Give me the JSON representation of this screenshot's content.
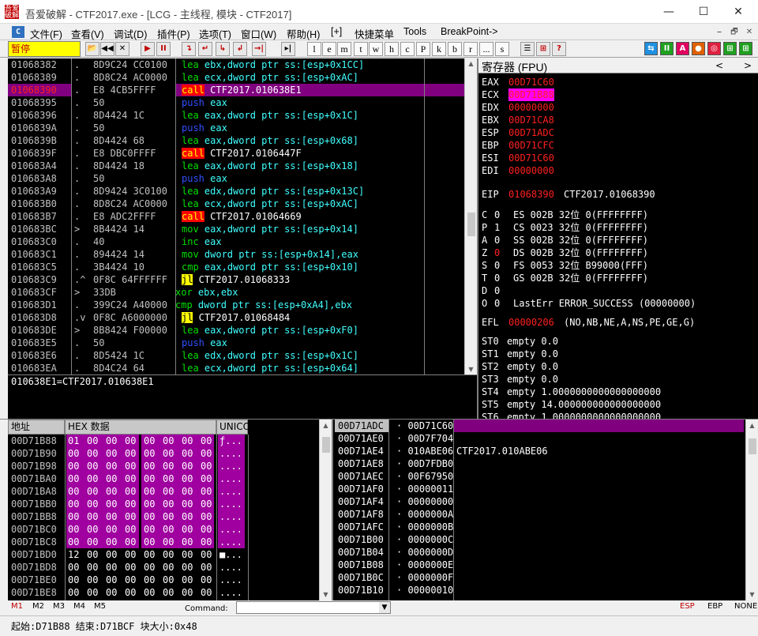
{
  "window": {
    "title": "吾爱破解 - CTF2017.exe - [LCG - 主线程, 模块 - CTF2017]",
    "icon": "吾爱破解",
    "minimize": "—",
    "maximize": "☐",
    "close": "✕"
  },
  "menu": {
    "icon": "C",
    "items": [
      "文件(F)",
      "查看(V)",
      "调试(D)",
      "插件(P)",
      "选项(T)",
      "窗口(W)",
      "帮助(H)",
      "[+]",
      "快捷菜单",
      "Tools",
      "BreakPoint->"
    ],
    "mdi": [
      "⎯",
      "🗗",
      "✕"
    ]
  },
  "toolbar": {
    "state": "暂停",
    "buttons": [
      "📂",
      "◀◀",
      "✕",
      "▶",
      "II",
      "↴",
      "↵",
      "↳",
      "↲",
      "→|",
      "▸|"
    ],
    "letters": [
      "l",
      "e",
      "m",
      "t",
      "w",
      "h",
      "c",
      "P",
      "k",
      "b",
      "r",
      "...",
      "s"
    ],
    "right": [
      "☰",
      "⊞",
      "?"
    ],
    "colorbtns": [
      "⇆",
      "II",
      "A",
      "●",
      "◎",
      "⊞",
      "⊞",
      "⊞",
      "⊞",
      "⊞"
    ]
  },
  "disasm": {
    "rows": [
      {
        "addr": "01068382",
        "mark": ".",
        "hex": "8D9C24 CC0100",
        "asm": [
          {
            "t": "lea ",
            "c": "green"
          },
          {
            "t": "ebx",
            "c": "cyan"
          },
          {
            "t": ",dword ptr ss:[esp+0x1CC]",
            "c": "cyan"
          }
        ]
      },
      {
        "addr": "01068389",
        "mark": ".",
        "hex": "8D8C24 AC0000",
        "asm": [
          {
            "t": "lea ",
            "c": "green"
          },
          {
            "t": "ecx",
            "c": "cyan"
          },
          {
            "t": ",dword ptr ss:[esp+0xAC]",
            "c": "cyan"
          }
        ]
      },
      {
        "addr": "01068390",
        "mark": ".",
        "hex": "E8 4CB5FFFF",
        "sel": true,
        "asm": [
          {
            "t": "call",
            "c": "callbox"
          },
          {
            "t": " CTF2017.010638E1",
            "c": "white"
          }
        ]
      },
      {
        "addr": "01068395",
        "mark": ".",
        "hex": "50",
        "asm": [
          {
            "t": "push ",
            "c": "blue"
          },
          {
            "t": "eax",
            "c": "cyan"
          }
        ]
      },
      {
        "addr": "01068396",
        "mark": ".",
        "hex": "8D4424 1C",
        "asm": [
          {
            "t": "lea ",
            "c": "green"
          },
          {
            "t": "eax",
            "c": "cyan"
          },
          {
            "t": ",dword ptr ss:[esp+0x1C]",
            "c": "cyan"
          }
        ]
      },
      {
        "addr": "0106839A",
        "mark": ".",
        "hex": "50",
        "asm": [
          {
            "t": "push ",
            "c": "blue"
          },
          {
            "t": "eax",
            "c": "cyan"
          }
        ]
      },
      {
        "addr": "0106839B",
        "mark": ".",
        "hex": "8D4424 68",
        "asm": [
          {
            "t": "lea ",
            "c": "green"
          },
          {
            "t": "eax",
            "c": "cyan"
          },
          {
            "t": ",dword ptr ss:[esp+0x68]",
            "c": "cyan"
          }
        ]
      },
      {
        "addr": "0106839F",
        "mark": ".",
        "hex": "E8 DBC0FFFF",
        "asm": [
          {
            "t": "call",
            "c": "callbox"
          },
          {
            "t": " CTF2017.0106447F",
            "c": "white"
          }
        ]
      },
      {
        "addr": "010683A4",
        "mark": ".",
        "hex": "8D4424 18",
        "asm": [
          {
            "t": "lea ",
            "c": "green"
          },
          {
            "t": "eax",
            "c": "cyan"
          },
          {
            "t": ",dword ptr ss:[esp+0x18]",
            "c": "cyan"
          }
        ]
      },
      {
        "addr": "010683A8",
        "mark": ".",
        "hex": "50",
        "asm": [
          {
            "t": "push ",
            "c": "blue"
          },
          {
            "t": "eax",
            "c": "cyan"
          }
        ]
      },
      {
        "addr": "010683A9",
        "mark": ".",
        "hex": "8D9424 3C0100",
        "asm": [
          {
            "t": "lea ",
            "c": "green"
          },
          {
            "t": "edx",
            "c": "cyan"
          },
          {
            "t": ",dword ptr ss:[esp+0x13C]",
            "c": "cyan"
          }
        ]
      },
      {
        "addr": "010683B0",
        "mark": ".",
        "hex": "8D8C24 AC0000",
        "asm": [
          {
            "t": "lea ",
            "c": "green"
          },
          {
            "t": "ecx",
            "c": "cyan"
          },
          {
            "t": ",dword ptr ss:[esp+0xAC]",
            "c": "cyan"
          }
        ]
      },
      {
        "addr": "010683B7",
        "mark": ".",
        "hex": "E8 ADC2FFFF",
        "asm": [
          {
            "t": "call",
            "c": "callbox"
          },
          {
            "t": " CTF2017.01064669",
            "c": "white"
          }
        ]
      },
      {
        "addr": "010683BC",
        "mark": ">",
        "hex": "8B4424 14",
        "asm": [
          {
            "t": "mov ",
            "c": "green"
          },
          {
            "t": "eax",
            "c": "cyan"
          },
          {
            "t": ",dword ptr ss:[esp+0x14]",
            "c": "cyan"
          }
        ]
      },
      {
        "addr": "010683C0",
        "mark": ".",
        "hex": "40",
        "asm": [
          {
            "t": "inc ",
            "c": "green"
          },
          {
            "t": "eax",
            "c": "cyan"
          }
        ]
      },
      {
        "addr": "010683C1",
        "mark": ".",
        "hex": "894424 14",
        "asm": [
          {
            "t": "mov ",
            "c": "green"
          },
          {
            "t": "dword ptr ss:[esp+0x14],eax",
            "c": "cyan"
          }
        ]
      },
      {
        "addr": "010683C5",
        "mark": ".",
        "hex": "3B4424 10",
        "asm": [
          {
            "t": "cmp ",
            "c": "green"
          },
          {
            "t": "eax",
            "c": "cyan"
          },
          {
            "t": ",dword ptr ss:[esp+0x10]",
            "c": "cyan"
          }
        ]
      },
      {
        "addr": "010683C9",
        "mark": ".^",
        "hex": "0F8C 64FFFFFF",
        "asm": [
          {
            "t": "jl",
            "c": "jlbox"
          },
          {
            "t": " CTF2017.01068333",
            "c": "white"
          }
        ]
      },
      {
        "addr": "010683CF",
        "mark": ">",
        "hex": "33DB",
        "asm": [
          {
            "t": "xor ",
            "c": "green"
          },
          {
            "t": "ebx",
            "c": "cyan"
          },
          {
            "t": ",ebx",
            "c": "cyan"
          }
        ],
        "shift": true
      },
      {
        "addr": "010683D1",
        "mark": ".",
        "hex": "399C24 A40000",
        "asm": [
          {
            "t": "cmp ",
            "c": "green"
          },
          {
            "t": "dword ptr ss:[esp+0xA4],ebx",
            "c": "cyan"
          }
        ],
        "shift": true
      },
      {
        "addr": "010683D8",
        "mark": ".v",
        "hex": "0F8C A6000000",
        "asm": [
          {
            "t": "jl",
            "c": "jlbox"
          },
          {
            "t": " CTF2017.01068484",
            "c": "white"
          }
        ]
      },
      {
        "addr": "010683DE",
        "mark": ">",
        "hex": "8B8424 F00000",
        "asm": [
          {
            "t": "lea ",
            "c": "green"
          },
          {
            "t": "eax",
            "c": "cyan"
          },
          {
            "t": ",dword ptr ss:[esp+0xF0]",
            "c": "cyan"
          }
        ]
      },
      {
        "addr": "010683E5",
        "mark": ".",
        "hex": "50",
        "asm": [
          {
            "t": "push ",
            "c": "blue"
          },
          {
            "t": "eax",
            "c": "cyan"
          }
        ]
      },
      {
        "addr": "010683E6",
        "mark": ".",
        "hex": "8D5424 1C",
        "asm": [
          {
            "t": "lea ",
            "c": "green"
          },
          {
            "t": "edx",
            "c": "cyan"
          },
          {
            "t": ",dword ptr ss:[esp+0x1C]",
            "c": "cyan"
          }
        ]
      },
      {
        "addr": "010683EA",
        "mark": ".",
        "hex": "8D4C24 64",
        "asm": [
          {
            "t": "lea ",
            "c": "green"
          },
          {
            "t": "ecx",
            "c": "cyan"
          },
          {
            "t": ",dword ptr ss:[esp+0x64]",
            "c": "cyan"
          }
        ]
      }
    ],
    "info": "010638E1=CTF2017.010638E1"
  },
  "registers": {
    "title": "寄存器 (FPU)",
    "gp": [
      [
        "EAX",
        "00D71C60"
      ],
      [
        "ECX",
        "00D71B88"
      ],
      [
        "EDX",
        "00000000"
      ],
      [
        "EBX",
        "00D71CA8"
      ],
      [
        "ESP",
        "00D71ADC"
      ],
      [
        "EBP",
        "00D71CFC"
      ],
      [
        "ESI",
        "00D71C60"
      ],
      [
        "EDI",
        "00000000"
      ]
    ],
    "eip": {
      "name": "EIP",
      "value": "01068390",
      "comment": "CTF2017.01068390"
    },
    "flags": [
      [
        "C",
        "0",
        "ES 002B 32位 0(FFFFFFFF)"
      ],
      [
        "P",
        "1",
        "CS 0023 32位 0(FFFFFFFF)"
      ],
      [
        "A",
        "0",
        "SS 002B 32位 0(FFFFFFFF)"
      ],
      [
        "Z",
        "0",
        "DS 002B 32位 0(FFFFFFFF)"
      ],
      [
        "S",
        "0",
        "FS 0053 32位 B99000(FFF)"
      ],
      [
        "T",
        "0",
        "GS 002B 32位 0(FFFFFFFF)"
      ],
      [
        "D",
        "0",
        ""
      ],
      [
        "O",
        "0",
        "LastErr ERROR_SUCCESS (00000000)"
      ]
    ],
    "efl": {
      "name": "EFL",
      "value": "00000206",
      "comment": "(NO,NB,NE,A,NS,PE,GE,G)"
    },
    "fpu": [
      [
        "ST0",
        "empty 0.0"
      ],
      [
        "ST1",
        "empty 0.0"
      ],
      [
        "ST2",
        "empty 0.0"
      ],
      [
        "ST3",
        "empty 0.0"
      ],
      [
        "ST4",
        "empty 1.0000000000000000000"
      ],
      [
        "ST5",
        "empty 14.000000000000000000"
      ],
      [
        "ST6",
        "empty 1.0000000000000000000"
      ]
    ]
  },
  "dump": {
    "headers": [
      "地址",
      "HEX 数据",
      "UNICO"
    ],
    "rows": [
      {
        "addr": "00D71B88",
        "hex": [
          "01",
          "00",
          "00",
          "00",
          "00",
          "00",
          "00",
          "00"
        ],
        "mag": true,
        "uni": "ƒ..."
      },
      {
        "addr": "00D71B90",
        "hex": [
          "00",
          "00",
          "00",
          "00",
          "00",
          "00",
          "00",
          "00"
        ],
        "mag": true,
        "uni": "...."
      },
      {
        "addr": "00D71B98",
        "hex": [
          "00",
          "00",
          "00",
          "00",
          "00",
          "00",
          "00",
          "00"
        ],
        "mag": true,
        "uni": "...."
      },
      {
        "addr": "00D71BA0",
        "hex": [
          "00",
          "00",
          "00",
          "00",
          "00",
          "00",
          "00",
          "00"
        ],
        "mag": true,
        "uni": "...."
      },
      {
        "addr": "00D71BA8",
        "hex": [
          "00",
          "00",
          "00",
          "00",
          "00",
          "00",
          "00",
          "00"
        ],
        "mag": true,
        "uni": "...."
      },
      {
        "addr": "00D71BB0",
        "hex": [
          "00",
          "00",
          "00",
          "00",
          "00",
          "00",
          "00",
          "00"
        ],
        "mag": true,
        "uni": "...."
      },
      {
        "addr": "00D71BB8",
        "hex": [
          "00",
          "00",
          "00",
          "00",
          "00",
          "00",
          "00",
          "00"
        ],
        "mag": true,
        "uni": "...."
      },
      {
        "addr": "00D71BC0",
        "hex": [
          "00",
          "00",
          "00",
          "00",
          "00",
          "00",
          "00",
          "00"
        ],
        "mag": true,
        "uni": "...."
      },
      {
        "addr": "00D71BC8",
        "hex": [
          "00",
          "00",
          "00",
          "00",
          "00",
          "00",
          "00",
          "00"
        ],
        "mag": true,
        "uni": "...."
      },
      {
        "addr": "00D71BD0",
        "hex": [
          "12",
          "00",
          "00",
          "00",
          "00",
          "00",
          "00",
          "00"
        ],
        "mag": false,
        "uni": "■..."
      },
      {
        "addr": "00D71BD8",
        "hex": [
          "00",
          "00",
          "00",
          "00",
          "00",
          "00",
          "00",
          "00"
        ],
        "mag": false,
        "uni": "...."
      },
      {
        "addr": "00D71BE0",
        "hex": [
          "00",
          "00",
          "00",
          "00",
          "00",
          "00",
          "00",
          "00"
        ],
        "mag": false,
        "uni": "...."
      },
      {
        "addr": "00D71BE8",
        "hex": [
          "00",
          "00",
          "00",
          "00",
          "00",
          "00",
          "00",
          "00"
        ],
        "mag": false,
        "uni": "...."
      }
    ]
  },
  "stack": {
    "rows": [
      {
        "addr": "00D71ADC",
        "val": "00D71C60",
        "comment": "",
        "sel": true
      },
      {
        "addr": "00D71AE0",
        "val": "00D7F704",
        "comment": ""
      },
      {
        "addr": "00D71AE4",
        "val": "010ABE06",
        "comment": "CTF2017.010ABE06"
      },
      {
        "addr": "00D71AE8",
        "val": "00D7FDB0",
        "comment": ""
      },
      {
        "addr": "00D71AEC",
        "val": "00F67950",
        "comment": ""
      },
      {
        "addr": "00D71AF0",
        "val": "00000011",
        "comment": ""
      },
      {
        "addr": "00D71AF4",
        "val": "00000000",
        "comment": ""
      },
      {
        "addr": "00D71AF8",
        "val": "0000000A",
        "comment": ""
      },
      {
        "addr": "00D71AFC",
        "val": "0000000B",
        "comment": ""
      },
      {
        "addr": "00D71B00",
        "val": "0000000C",
        "comment": ""
      },
      {
        "addr": "00D71B04",
        "val": "0000000D",
        "comment": ""
      },
      {
        "addr": "00D71B08",
        "val": "0000000E",
        "comment": ""
      },
      {
        "addr": "00D71B0C",
        "val": "0000000F",
        "comment": ""
      },
      {
        "addr": "00D71B10",
        "val": "00000010",
        "comment": ""
      }
    ]
  },
  "bottom": {
    "tabs": [
      "M1",
      "M2",
      "M3",
      "M4",
      "M5"
    ],
    "command_label": "Command:",
    "command_value": "",
    "right": [
      "ESP",
      "EBP",
      "NONE"
    ],
    "status": "起始:D71B88 结束:D71BCF 块大小:0x48"
  },
  "colors": {
    "selection": "#800080",
    "call_bg": "#ff0000",
    "call_fg": "#ffff00",
    "jl_bg": "#ffff00",
    "reg_changed": "#ff2020",
    "toolbar_state_bg": "#ffff00"
  }
}
